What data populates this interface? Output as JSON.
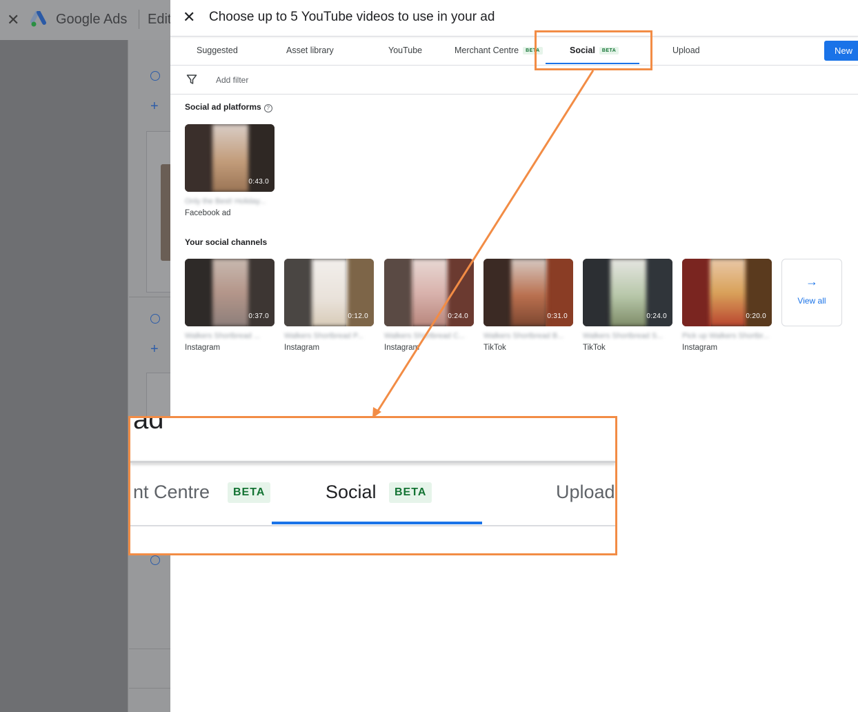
{
  "background_app": {
    "brand": "Google Ads",
    "edit_label": "Edit"
  },
  "dialog": {
    "title": "Choose up to 5 YouTube videos to use in your ad",
    "tabs": [
      {
        "label": "Suggested"
      },
      {
        "label": "Asset library"
      },
      {
        "label": "YouTube"
      },
      {
        "label": "Merchant Centre",
        "badge": "BETA"
      },
      {
        "label": "Social",
        "badge": "BETA",
        "active": true
      },
      {
        "label": "Upload"
      }
    ],
    "new_button": "New",
    "filter": {
      "placeholder": "Add filter"
    },
    "social_platforms": {
      "title": "Social ad platforms",
      "help": "?",
      "videos": [
        {
          "duration": "0:43.0",
          "title": "Only the Best! Holiday...",
          "source": "Facebook ad"
        }
      ]
    },
    "social_channels": {
      "title": "Your social channels",
      "videos": [
        {
          "duration": "0:37.0",
          "title": "Walkers Shortbread ...",
          "source": "Instagram"
        },
        {
          "duration": "0:12.0",
          "title": "Walkers Shortbread P...",
          "source": "Instagram"
        },
        {
          "duration": "0:24.0",
          "title": "Walkers Shortbread C...",
          "source": "Instagram"
        },
        {
          "duration": "0:31.0",
          "title": "Walkers Shortbread B...",
          "source": "TikTok"
        },
        {
          "duration": "0:24.0",
          "title": "Walkers Shortbread S...",
          "source": "TikTok"
        },
        {
          "duration": "0:20.0",
          "title": "Pick up Walkers Shortbr...",
          "source": "Instagram"
        }
      ],
      "view_all": "View all"
    }
  },
  "zoom_callout": {
    "title_fragment": "ad",
    "tab_left": "nt Centre",
    "tab_active": "Social",
    "tab_right": "Upload",
    "badge": "BETA"
  },
  "colors": {
    "accent": "#1a73e8",
    "annotation": "#f28c45",
    "beta_text": "#137333",
    "beta_bg": "#e6f4ea"
  }
}
